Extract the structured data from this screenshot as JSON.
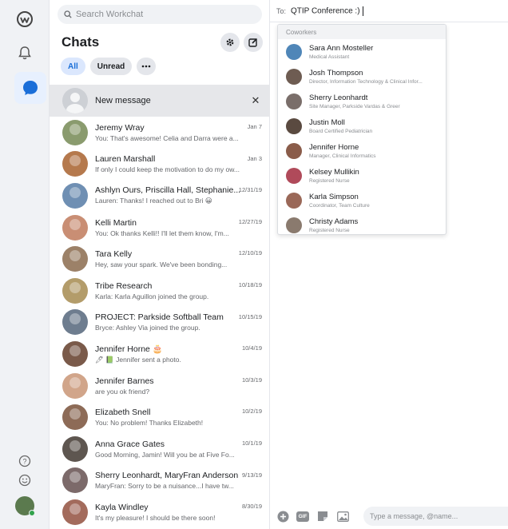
{
  "search": {
    "placeholder": "Search Workchat"
  },
  "panel": {
    "title": "Chats"
  },
  "filters": [
    "All",
    "Unread"
  ],
  "new_message": {
    "label": "New message"
  },
  "chats": [
    {
      "name": "Jeremy Wray",
      "preview": "You: That's awesome! Celia and Darra were a...",
      "date": "Jan 7",
      "color": "#8a9b6e"
    },
    {
      "name": "Lauren Marshall",
      "preview": "If only I could keep the motivation to do my ow...",
      "date": "Jan 3",
      "color": "#b5794d"
    },
    {
      "name": "Ashlyn Ours, Priscilla Hall, Stephanie...",
      "preview": "Lauren: Thanks! I reached out to Bri 😀",
      "date": "12/31/19",
      "color": "#6f8fb3"
    },
    {
      "name": "Kelli Martin",
      "preview": "You: Ok thanks Kelli!! I'll let them know, I'm...",
      "date": "12/27/19",
      "color": "#c98e74"
    },
    {
      "name": "Tara Kelly",
      "preview": "Hey, saw your spark. We've been bonding...",
      "date": "12/10/19",
      "color": "#9c8168"
    },
    {
      "name": "Tribe Research",
      "preview": "Karla: Karla Aguillon joined the group.",
      "date": "10/18/19",
      "color": "#b39c6a"
    },
    {
      "name": "PROJECT: Parkside Softball Team",
      "preview": "Bryce: Ashley Via joined the group.",
      "date": "10/15/19",
      "color": "#6e7d8f"
    },
    {
      "name": "Jennifer Horne 🎂",
      "preview": "🖊 📗 Jennifer sent a photo.",
      "date": "10/4/19",
      "color": "#7a5a4a"
    },
    {
      "name": "Jennifer Barnes",
      "preview": "are you ok friend?",
      "date": "10/3/19",
      "color": "#d1a58a"
    },
    {
      "name": "Elizabeth Snell",
      "preview": "You: No problem! Thanks Elizabeth!",
      "date": "10/2/19",
      "color": "#8d6b57"
    },
    {
      "name": "Anna Grace Gates",
      "preview": "Good Morning, Jamin! Will you be at Five Fo...",
      "date": "10/1/19",
      "color": "#5e5650"
    },
    {
      "name": "Sherry Leonhardt, MaryFran Anderson",
      "preview": "MaryFran: Sorry to be a nuisance...I have tw...",
      "date": "9/13/19",
      "color": "#7c6a6a"
    },
    {
      "name": "Kayla Windley",
      "preview": "It's my pleasure! I should be there soon!",
      "date": "8/30/19",
      "color": "#a36b5c"
    }
  ],
  "compose": {
    "to_label": "To:",
    "to_value": "QTIP Conference :)",
    "dropdown_header": "Coworkers",
    "coworkers": [
      {
        "name": "Sara Ann Mosteller",
        "role": "Medical Assistant",
        "color": "#4f86b8"
      },
      {
        "name": "Josh Thompson",
        "role": "Director, Information Technology & Clinical Infor...",
        "color": "#6e5c52"
      },
      {
        "name": "Sherry Leonhardt",
        "role": "Site Manager, Parkside Vardas & Greer",
        "color": "#7a6e6a"
      },
      {
        "name": "Justin Moll",
        "role": "Board Certified Pediatrician",
        "color": "#5a4a40"
      },
      {
        "name": "Jennifer Horne",
        "role": "Manager, Clinical Informatics",
        "color": "#8a5c4a"
      },
      {
        "name": "Kelsey Mullikin",
        "role": "Registered Nurse",
        "color": "#b04a5a"
      },
      {
        "name": "Karla Simpson",
        "role": "Coordinator, Team Culture",
        "color": "#9a6858"
      },
      {
        "name": "Christy Adams",
        "role": "Registered Nurse",
        "color": "#8a7a6e"
      }
    ],
    "message_placeholder": "Type a message, @name...",
    "gif_label": "GIF"
  },
  "colors": {
    "accent": "#1a6ed8",
    "rail_bg": "#f0f2f5",
    "active_bg": "#e7f0fe"
  }
}
